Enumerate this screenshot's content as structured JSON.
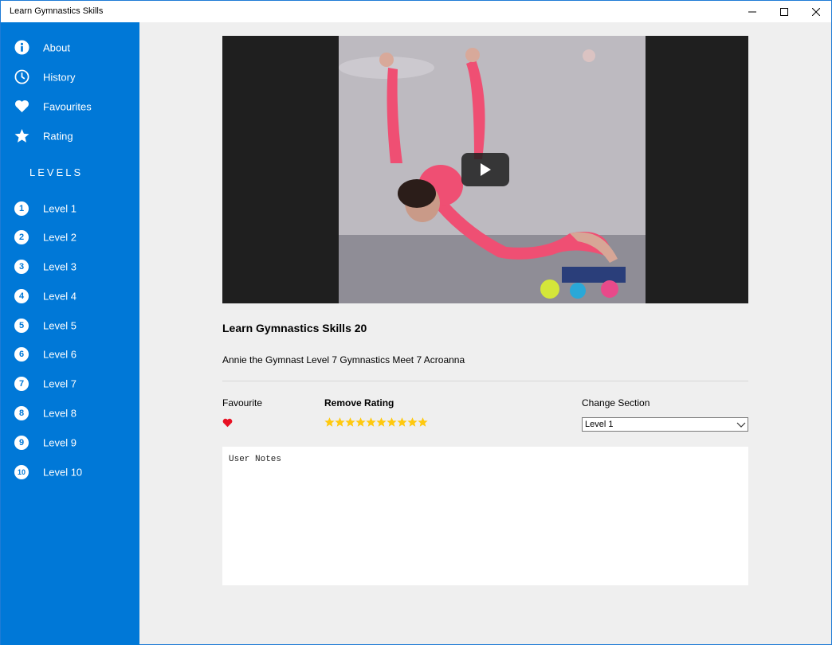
{
  "window": {
    "title": "Learn Gymnastics Skills"
  },
  "sidebar": {
    "menu": [
      {
        "label": "About",
        "icon": "info-icon"
      },
      {
        "label": "History",
        "icon": "clock-icon"
      },
      {
        "label": "Favourites",
        "icon": "heart-icon"
      },
      {
        "label": "Rating",
        "icon": "star-icon"
      }
    ],
    "levels_header": "LEVELS",
    "levels": [
      {
        "num": "1",
        "label": "Level 1"
      },
      {
        "num": "2",
        "label": "Level 2"
      },
      {
        "num": "3",
        "label": "Level 3"
      },
      {
        "num": "4",
        "label": "Level 4"
      },
      {
        "num": "5",
        "label": "Level 5"
      },
      {
        "num": "6",
        "label": "Level 6"
      },
      {
        "num": "7",
        "label": "Level 7"
      },
      {
        "num": "8",
        "label": "Level 8"
      },
      {
        "num": "9",
        "label": "Level 9"
      },
      {
        "num": "10",
        "label": "Level 10"
      }
    ]
  },
  "video": {
    "title": "Learn Gymnastics Skills 20",
    "description": "Annie the Gymnast Level 7 Gymnastics Meet 7 Acroanna"
  },
  "details": {
    "favourite_label": "Favourite",
    "favourite_active": true,
    "rating_label": "Remove Rating",
    "rating_stars": 10,
    "section_label": "Change Section",
    "section_value": "Level 1"
  },
  "notes": {
    "placeholder": "User Notes"
  },
  "colors": {
    "sidebar": "#0078d7",
    "heart": "#e81123",
    "star": "#ffc90e"
  }
}
